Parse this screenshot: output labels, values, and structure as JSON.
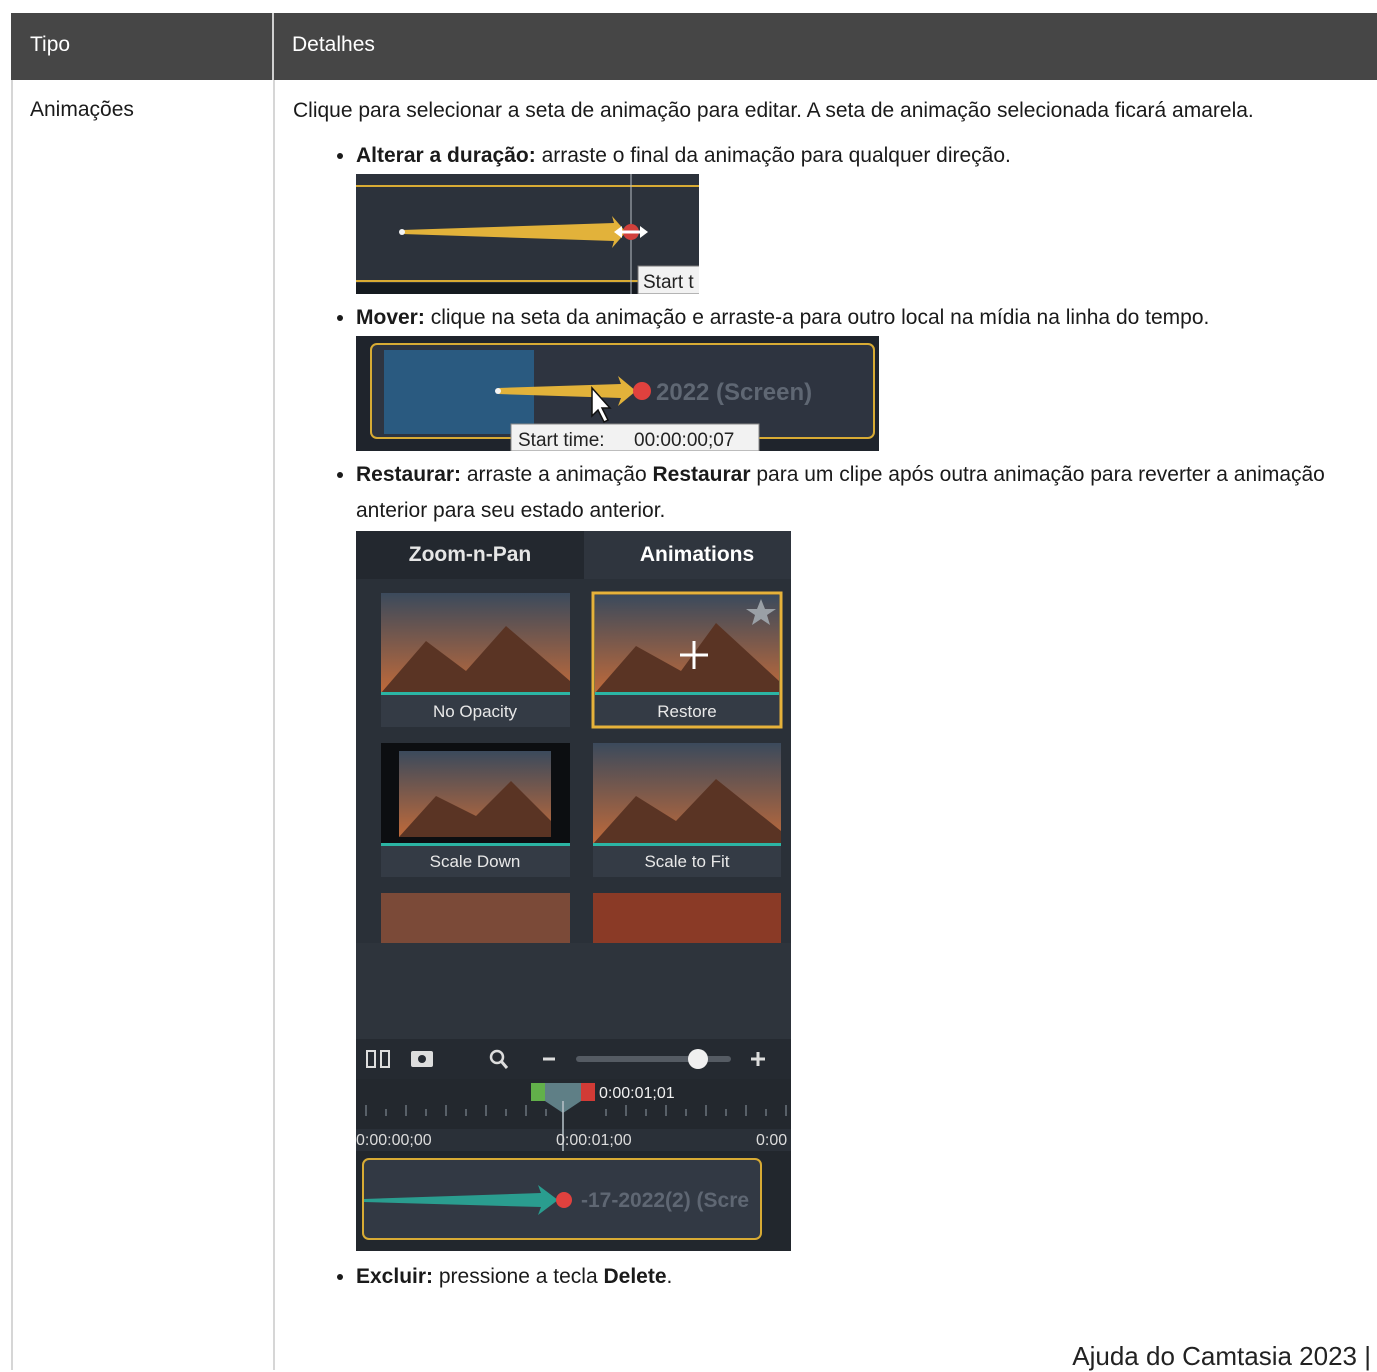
{
  "table": {
    "headers": [
      "Tipo",
      "Detalhes"
    ],
    "row": {
      "type": "Animações",
      "intro": "Clique para selecionar a seta de animação para editar. A seta de animação selecionada ficará amarela.",
      "items": [
        {
          "term": "Alterar a duração:",
          "text": " arraste o final da animação para qualquer direção."
        },
        {
          "term": "Mover:",
          "text": " clique na seta da animação e arraste-a para outro local na mídia na linha do tempo."
        },
        {
          "term": "Restaurar:",
          "text_a": " arraste a animação ",
          "term2": "Restaurar",
          "text_b": " para um clipe após outra animação para reverter a animação anterior para seu estado anterior."
        },
        {
          "term": "Excluir:",
          "text_a": " pressione a tecla ",
          "term2": "Delete",
          "text_b": "."
        }
      ]
    }
  },
  "screenshots": {
    "duration": {
      "tooltip": "Start t"
    },
    "move": {
      "clip_label": "2022 (Screen)",
      "tooltip_label": "Start time:",
      "tooltip_value": "00:00:00;07"
    },
    "restore": {
      "tabs": [
        "Zoom-n-Pan",
        "Animations"
      ],
      "presets": [
        "No Opacity",
        "Restore",
        "Scale Down",
        "Scale to Fit"
      ],
      "playhead_time": "0:00:01;01",
      "ruler_labels": [
        "0:00:00;00",
        "0:00:01;00",
        "0:00"
      ],
      "clip_label": "-17-2022(2) (Scre"
    }
  },
  "footer": "Ajuda do Camtasia 2023 |"
}
